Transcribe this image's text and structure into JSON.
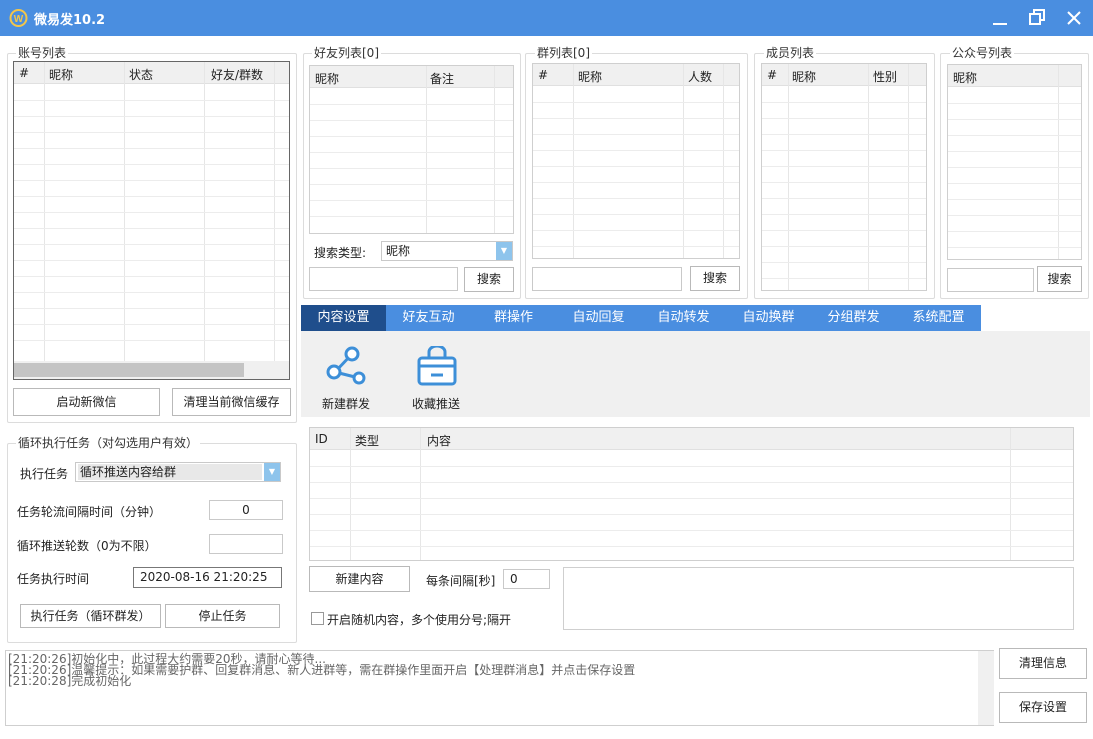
{
  "app": {
    "title": "微易发10.2"
  },
  "accounts": {
    "title": "账号列表",
    "columns": [
      "#",
      "昵称",
      "状态",
      "好友/群数"
    ],
    "start_button": "启动新微信",
    "clear_button": "清理当前微信缓存"
  },
  "friends": {
    "title": "好友列表[0]",
    "columns": [
      "昵称",
      "备注"
    ],
    "search_type_label": "搜索类型:",
    "search_type_value": "昵称",
    "search_button": "搜索"
  },
  "groups": {
    "title": "群列表[0]",
    "columns": [
      "#",
      "昵称",
      "人数"
    ],
    "search_button": "搜索"
  },
  "members": {
    "title": "成员列表",
    "columns": [
      "#",
      "昵称",
      "性别"
    ]
  },
  "official": {
    "title": "公众号列表",
    "columns": [
      "昵称"
    ],
    "search_button": "搜索"
  },
  "loop": {
    "title": "循环执行任务（对勾选用户有效）",
    "task_label": "执行任务",
    "task_value": "循环推送内容给群",
    "interval_label": "任务轮流间隔时间（分钟）",
    "interval_value": "0",
    "rounds_label": "循环推送轮数（0为不限）",
    "rounds_value": "",
    "time_label": "任务执行时间",
    "time_value": "2020-08-16 21:20:25",
    "run_button": "执行任务（循环群发）",
    "stop_button": "停止任务"
  },
  "tabs": [
    "内容设置",
    "好友互动",
    "群操作",
    "自动回复",
    "自动转发",
    "自动换群",
    "分组群发",
    "系统配置"
  ],
  "content": {
    "actions": [
      {
        "label": "新建群发",
        "icon": "share-icon"
      },
      {
        "label": "收藏推送",
        "icon": "shopping-bag-icon"
      }
    ],
    "columns": [
      "ID",
      "类型",
      "内容"
    ],
    "new_button": "新建内容",
    "interval_label": "每条间隔[秒]",
    "interval_value": "0",
    "random_label": "开启随机内容，多个使用分号;隔开"
  },
  "log": {
    "lines": [
      "[21:20:26]初始化中，此过程大约需要20秒，请耐心等待...",
      "[21:20:26]温馨提示：如果需要护群、回复群消息、新人进群等，需在群操作里面开启【处理群消息】并点击保存设置",
      "[21:20:28]完成初始化"
    ]
  },
  "bottom_buttons": {
    "clear": "清理信息",
    "save": "保存设置"
  },
  "colors": {
    "titlebar": "#4a8ee0",
    "tab_bar": "#4a8ee0",
    "tab_active": "#1f4e8c",
    "panel": "#f0f0f0"
  }
}
